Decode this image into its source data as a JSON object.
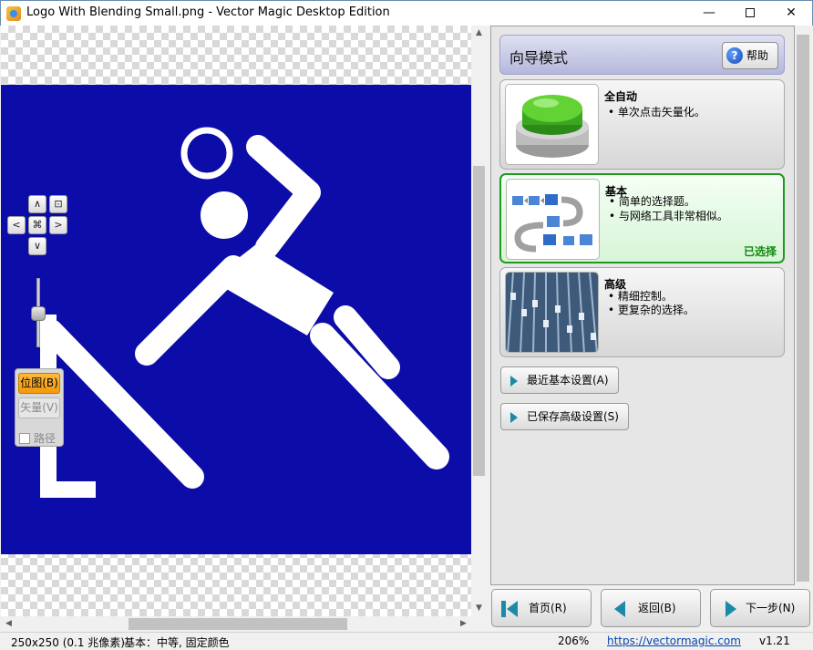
{
  "window": {
    "title": "Logo With Blending Small.png - Vector Magic Desktop Edition",
    "controls": {
      "minimize": "—",
      "close": "✕"
    }
  },
  "canvas": {
    "background_color": "#0c0ca8",
    "figure_color": "#ffffff"
  },
  "navpad": {
    "up": "∧",
    "down": "∨",
    "left": "<",
    "right": ">",
    "fit": "⊡",
    "center": "⌘"
  },
  "view_panel": {
    "bitmap_label": "位图(B)",
    "vector_label": "矢量(V)",
    "path_label": "路径"
  },
  "wizard": {
    "header_title": "向导模式",
    "help_label": "帮助",
    "options": [
      {
        "title": "全自动",
        "bullets": [
          "单次点击矢量化。"
        ],
        "selected": false,
        "image": "green-button"
      },
      {
        "title": "基本",
        "bullets": [
          "简单的选择题。",
          "与网络工具非常相似。"
        ],
        "selected": true,
        "selected_label": "已选择",
        "image": "flow-diagram"
      },
      {
        "title": "高级",
        "bullets": [
          "精细控制。",
          "更复杂的选择。"
        ],
        "selected": false,
        "image": "mixing-console"
      }
    ],
    "recent_settings_label": "最近基本设置(A)",
    "saved_settings_label": "已保存高级设置(S)"
  },
  "nav": {
    "home_label": "首页(R)",
    "back_label": "返回(B)",
    "next_label": "下一步(N)"
  },
  "status": {
    "image_info": "250x250 (0.1 兆像素)",
    "mode_info": "基本：中等, 固定颜色",
    "zoom": "206%",
    "url": "https://vectormagic.com",
    "version": "v1.21"
  }
}
